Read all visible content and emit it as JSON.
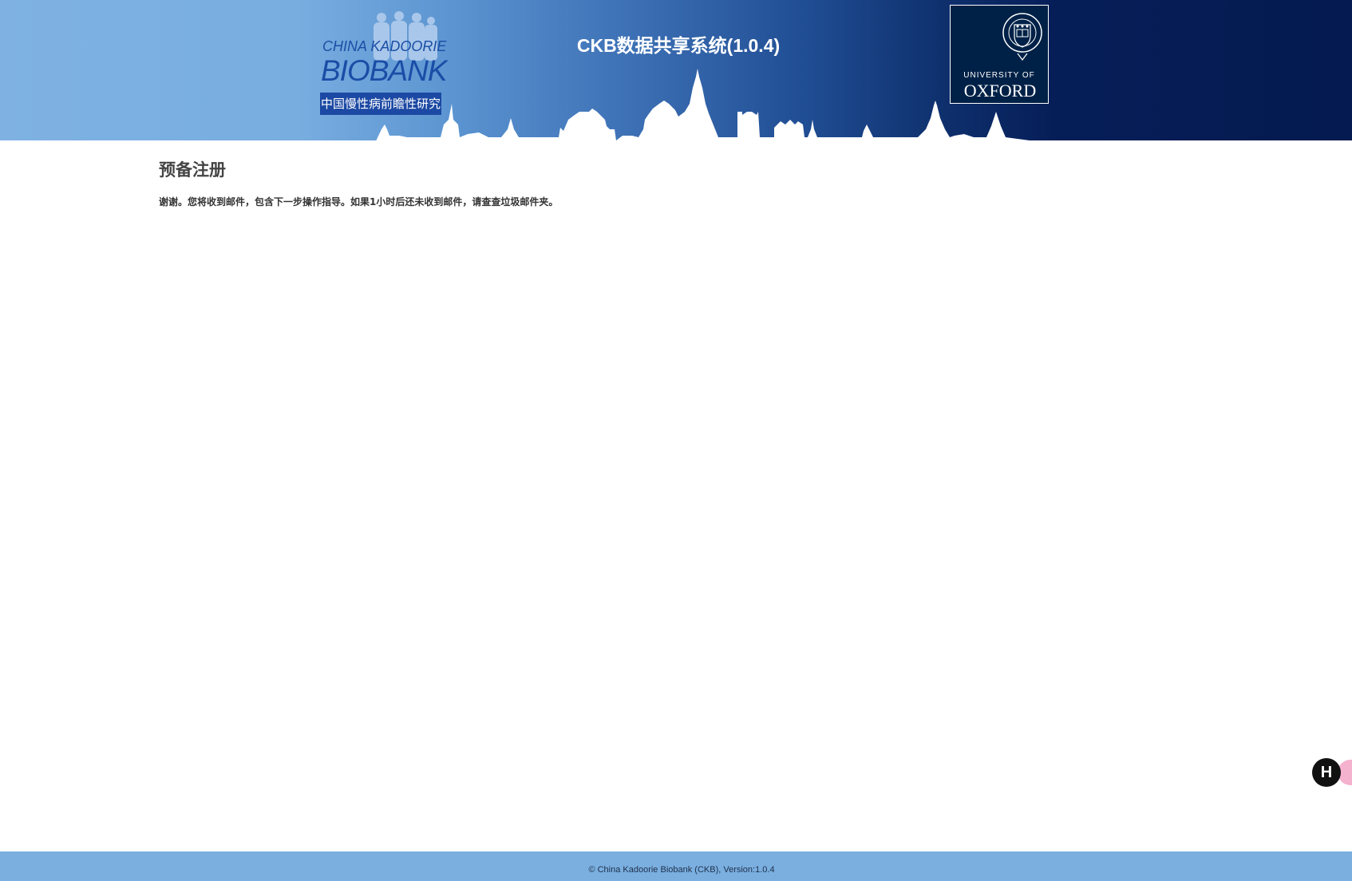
{
  "header": {
    "app_title": "CKB数据共享系统(1.0.4)",
    "ckb_logo": {
      "line1": "CHINA KADOORIE",
      "line2": "BIOBANK",
      "banner": "中国慢性病前瞻性研究"
    },
    "oxford_logo": {
      "university_of": "UNIVERSITY OF",
      "name": "OXFORD"
    }
  },
  "main": {
    "title": "预备注册",
    "message": "谢谢。您将收到邮件，包含下一步操作指导。如果1小时后还未收到邮件，请查查垃圾邮件夹。"
  },
  "floating_widget": {
    "icon": "h-assistant-icon",
    "label": "H"
  },
  "footer": {
    "copyright": "© China Kadoorie Biobank (CKB), Version:1.0.4"
  },
  "colors": {
    "header_gradient_start": "#7fb2e3",
    "header_gradient_end": "#041a50",
    "ckb_blue": "#1c49a3",
    "oxford_navy": "#002147",
    "footer_bg": "#7aafe0",
    "title_text": "#444444"
  }
}
